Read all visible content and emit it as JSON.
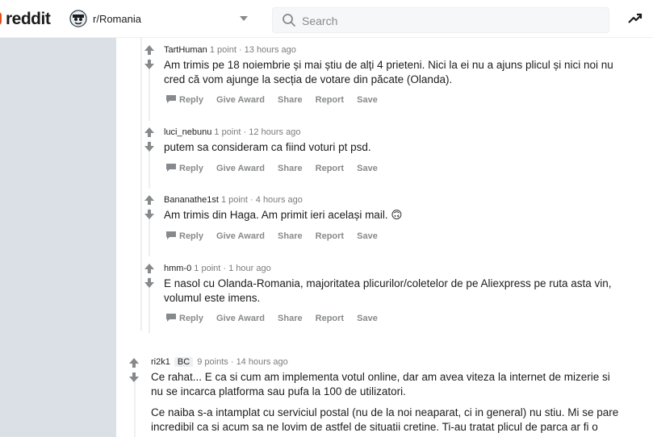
{
  "header": {
    "logo_text": "reddit",
    "community": "r/Romania",
    "search_placeholder": "Search",
    "brand_color": "#ff4500"
  },
  "actions": {
    "reply": "Reply",
    "give_award": "Give Award",
    "share": "Share",
    "report": "Report",
    "save": "Save"
  },
  "comments": [
    {
      "author": "TartHuman",
      "points": "1 point",
      "time": "13 hours ago",
      "text": "Am trimis pe 18 noiembrie și mai știu de alți 4 prieteni. Nici la ei nu a ajuns plicul și nici noi nu cred că vom ajunge la secția de votare din păcate (Olanda)."
    },
    {
      "author": "luci_nebunu",
      "points": "1 point",
      "time": "12 hours ago",
      "text": "putem sa consideram ca fiind voturi pt psd."
    },
    {
      "author": "Bananathe1st",
      "points": "1 point",
      "time": "4 hours ago",
      "text": "Am trimis din Haga. Am primit ieri același mail. 🙃"
    },
    {
      "author": "hmm-0",
      "points": "1 point",
      "time": "1 hour ago",
      "text": "E nasol cu Olanda-Romania, majoritatea plicurilor/coletelor de pe Aliexpress pe ruta asta vin, volumul este imens."
    },
    {
      "author": "ri2k1",
      "flair": "BC",
      "points": "9 points",
      "time": "14 hours ago",
      "text": "Ce rahat... E ca si cum am implementa votul online, dar am avea viteza la internet de mizerie si nu se incarca platforma sau pufa la 100 de utilizatori.",
      "text2": "Ce naiba s-a intamplat cu serviciul postal (nu de la noi neaparat, ci in general) nu stiu. Mi se pare incredibil ca si acum sa ne lovim de astfel de situatii cretine. Ti-au tratat plicul de parca ar fi o"
    }
  ]
}
